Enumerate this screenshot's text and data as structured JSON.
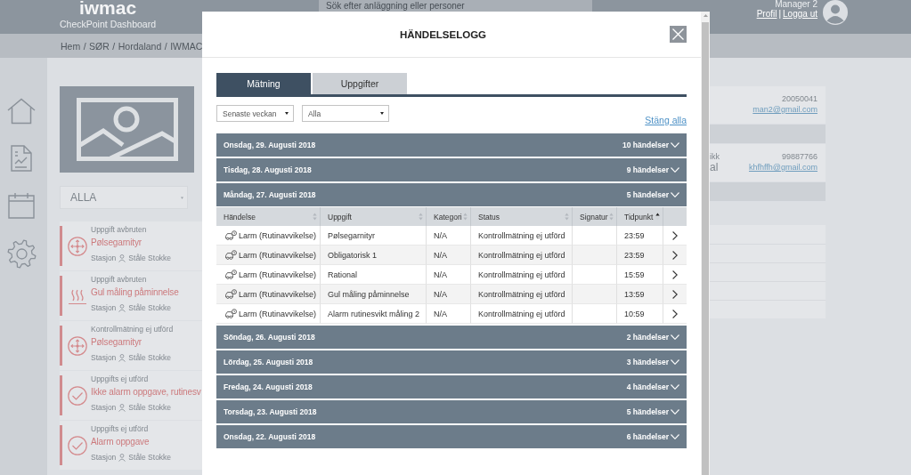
{
  "header": {
    "logo": "iwmac",
    "subtitle": "CheckPoint Dashboard",
    "search": {
      "placeholder": "Sök efter anläggning eller personer"
    },
    "user": {
      "name": "Manager 2",
      "links": [
        "Profil",
        "Logga ut"
      ],
      "link_separator": "|"
    }
  },
  "breadcrumb": {
    "items": [
      "Hem",
      "SØR",
      "Hordaland",
      "IWMAC"
    ],
    "separator": "/"
  },
  "station": {
    "filter": "ALLA",
    "events": [
      {
        "kind": "measurement",
        "status": "Uppgift avbruten",
        "title": "Pølsegarnityr",
        "location": "Stasjon",
        "person": "Ståle Stokke"
      },
      {
        "kind": "temperature",
        "status": "Uppgift avbruten",
        "title": "Gul måling påminnelse",
        "location": "Stasjon",
        "person": "Ståle Stokke"
      },
      {
        "kind": "measurement",
        "status": "Kontrollmätning ej utförd",
        "title": "Pølsegarnityr",
        "location": "Stasjon",
        "person": "Ståle Stokke"
      },
      {
        "kind": "task",
        "status": "Uppgifts ej utförd",
        "title": "Ikke alarm oppgave, rutinesv",
        "location": "Stasjon",
        "person": "Ståle Stokke"
      },
      {
        "kind": "task",
        "status": "Uppgifts ej utförd",
        "title": "Alarm oppgave",
        "location": "Stasjon",
        "person": "Ståle Stokke"
      }
    ]
  },
  "contacts": [
    {
      "number": "20050041",
      "email": "man2@gmail.com"
    },
    {
      "fragments": [
        "ikk",
        "al"
      ],
      "number": "99887766",
      "email": "khfhffh@gmail.com"
    }
  ],
  "modal": {
    "title": "HÄNDELSELOGG",
    "tabs": [
      {
        "label": "Mätning",
        "selected": true
      },
      {
        "label": "Uppgifter",
        "selected": false
      }
    ],
    "filters": [
      {
        "value": "Senaste veckan"
      },
      {
        "value": "Alla"
      }
    ],
    "close_all": "Stäng alla",
    "groups": [
      {
        "date": "Onsdag, 29. Augusti 2018",
        "count": "10 händelser"
      },
      {
        "date": "Tisdag, 28. Augusti 2018",
        "count": "9 händelser"
      },
      {
        "date": "Måndag, 27. Augusti 2018",
        "count": "5 händelser",
        "table": {
          "columns": [
            {
              "label": "Händelse",
              "sorted": false
            },
            {
              "label": "Uppgift",
              "sorted": false
            },
            {
              "label": "Kategori",
              "sorted": false
            },
            {
              "label": "Status",
              "sorted": false
            },
            {
              "label": "Signatur",
              "sorted": false
            },
            {
              "label": "Tidpunkt",
              "sorted": true
            }
          ],
          "rows": [
            {
              "event": "Larm (Rutinavvikelse)",
              "task": "Pølsegarnityr",
              "category": "N/A",
              "status": "Kontrollmätning ej utförd",
              "time": "23:59"
            },
            {
              "event": "Larm (Rutinavvikelse)",
              "task": "Obligatorisk 1",
              "category": "N/A",
              "status": "Kontrollmätning ej utförd",
              "time": "23:59"
            },
            {
              "event": "Larm (Rutinavvikelse)",
              "task": "Rational",
              "category": "N/A",
              "status": "Kontrollmätning ej utförd",
              "time": "15:59"
            },
            {
              "event": "Larm (Rutinavvikelse)",
              "task": "Gul måling påminnelse",
              "category": "N/A",
              "status": "Kontrollmätning ej utförd",
              "time": "13:59"
            },
            {
              "event": "Larm (Rutinavvikelse)",
              "task": "Alarm rutinesvikt måling 2",
              "category": "N/A",
              "status": "Kontrollmätning ej utförd",
              "time": "10:59"
            }
          ]
        }
      },
      {
        "date": "Söndag, 26. Augusti 2018",
        "count": "2 händelser"
      },
      {
        "date": "Lördag, 25. Augusti 2018",
        "count": "3 händelser"
      },
      {
        "date": "Fredag, 24. Augusti 2018",
        "count": "4 händelser"
      },
      {
        "date": "Torsdag, 23. Augusti 2018",
        "count": "5 händelser"
      },
      {
        "date": "Onsdag, 22. Augusti 2018",
        "count": "6 händelser"
      }
    ]
  }
}
